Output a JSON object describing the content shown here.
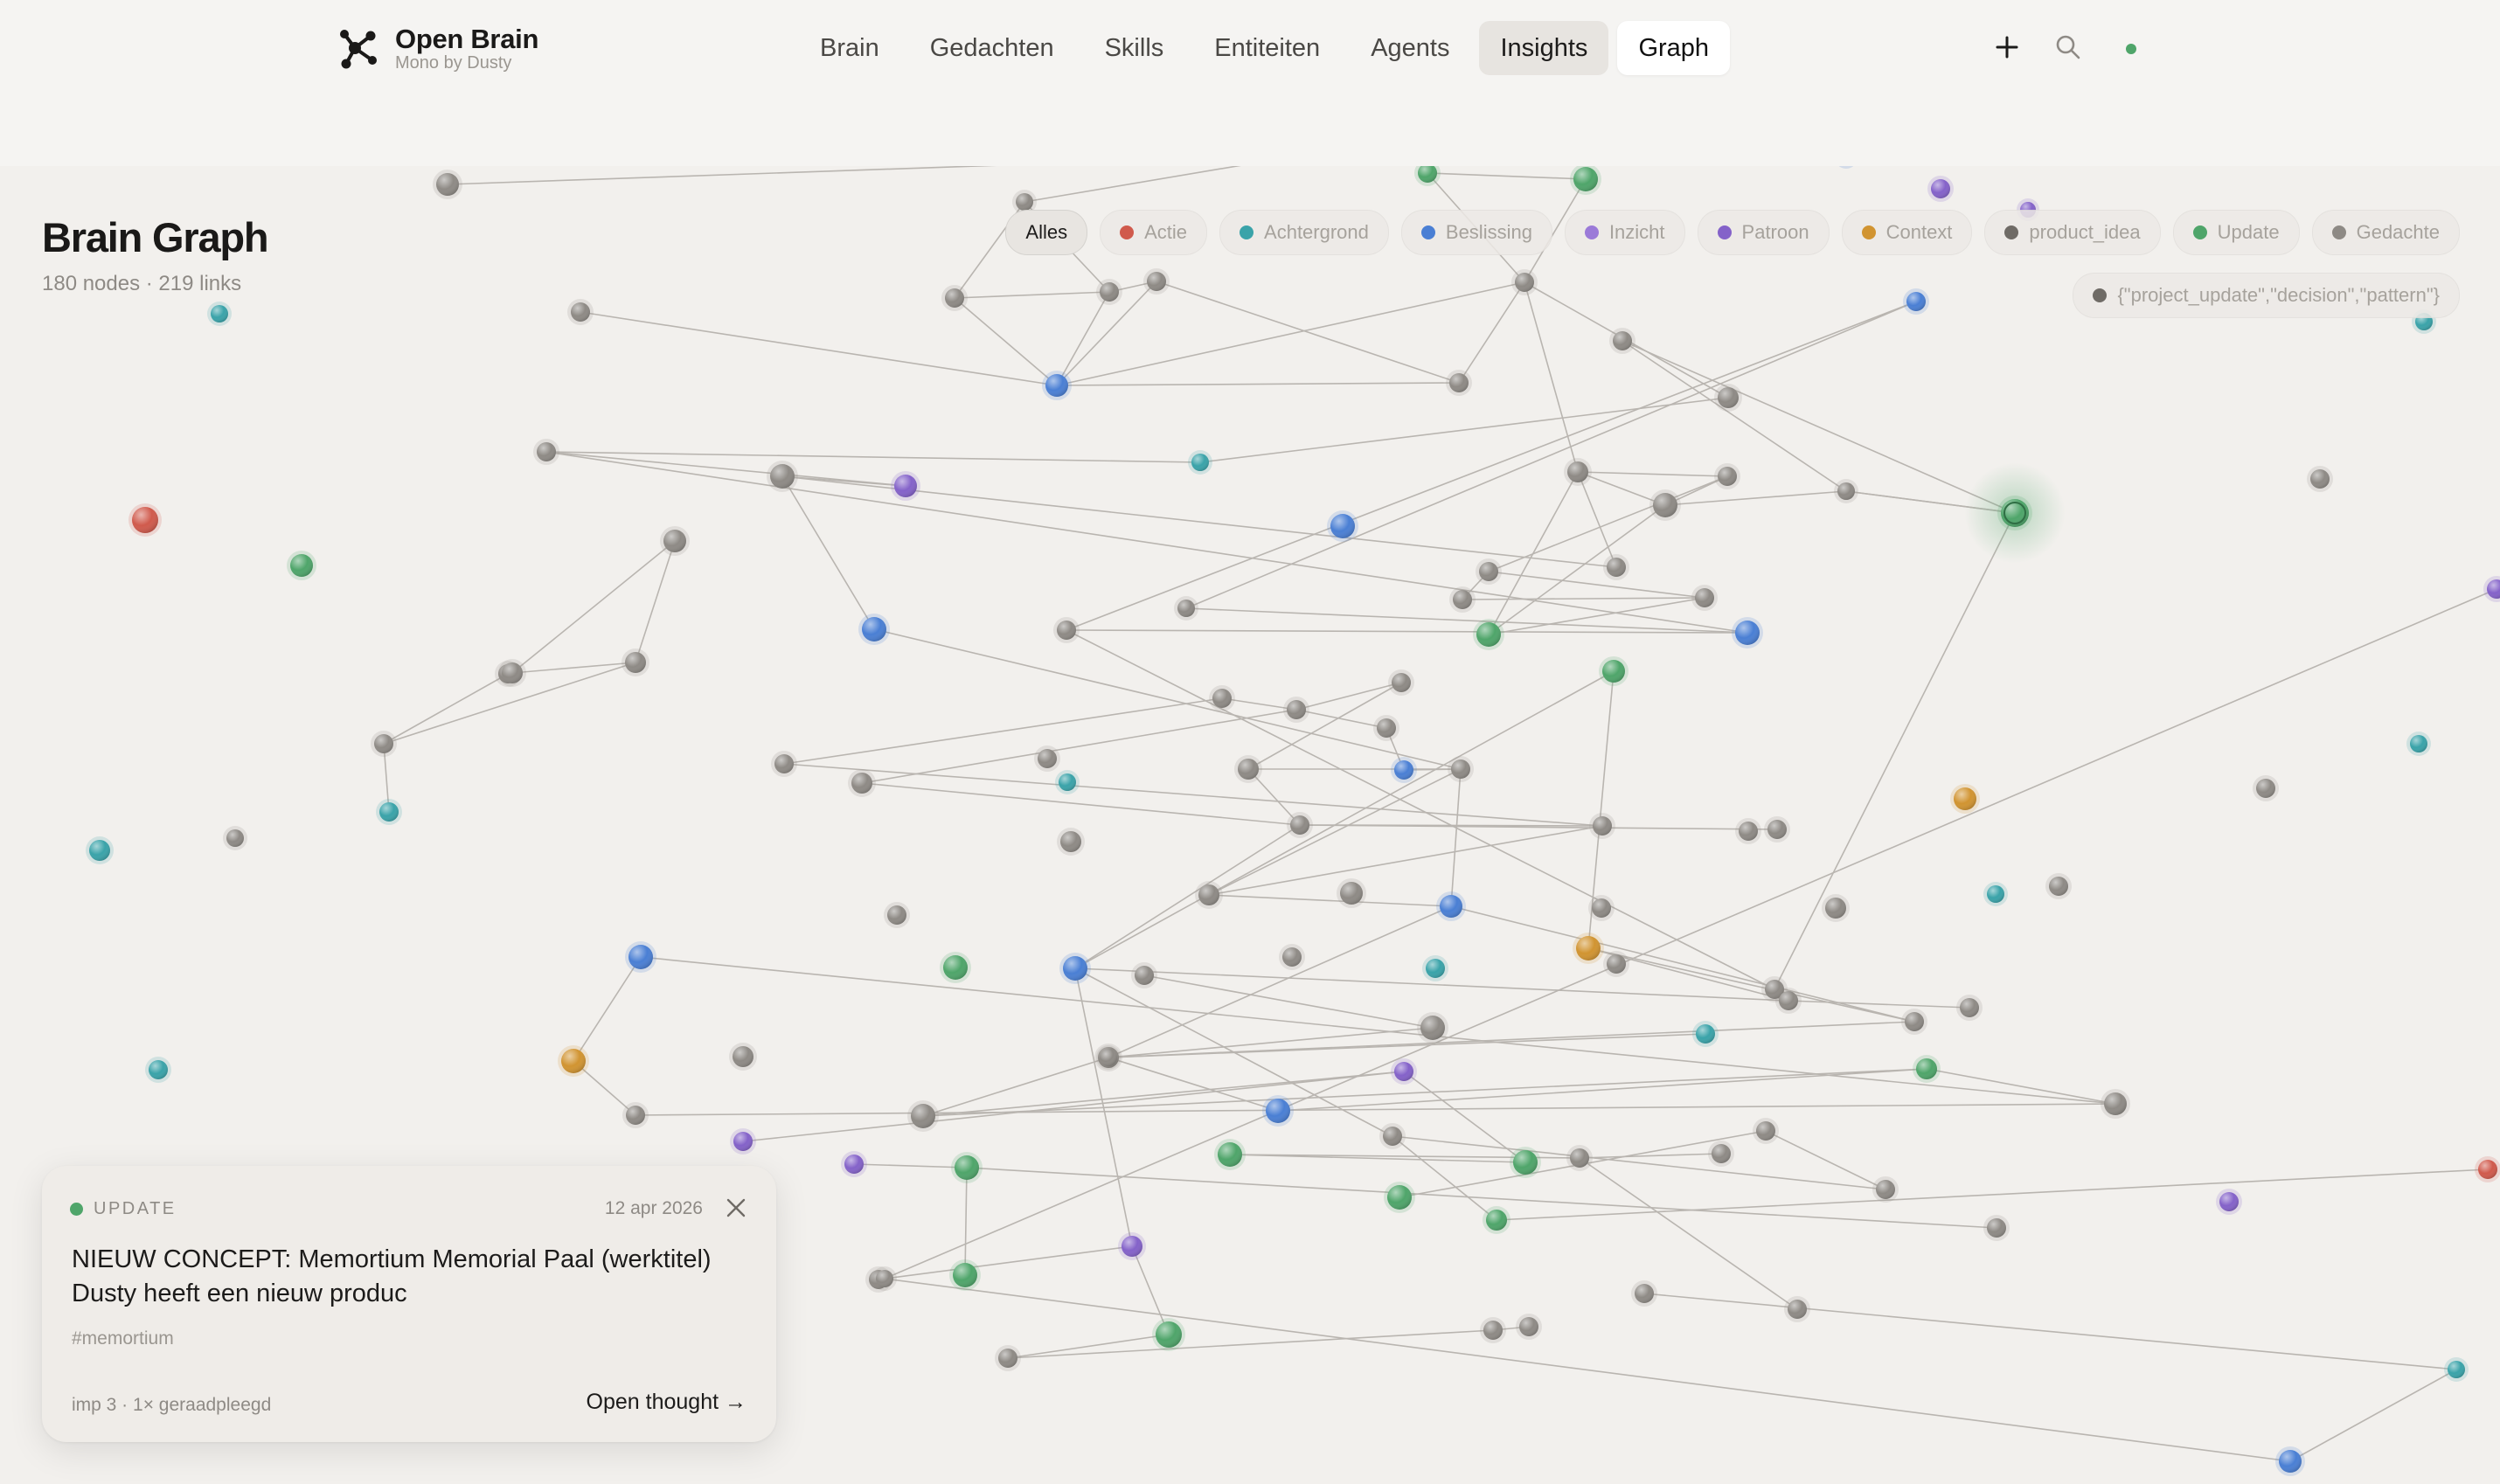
{
  "app": {
    "name": "Open Brain",
    "subtitle": "Mono by Dusty"
  },
  "nav": {
    "items": [
      {
        "label": "Brain"
      },
      {
        "label": "Gedachten"
      },
      {
        "label": "Skills"
      },
      {
        "label": "Entiteiten"
      },
      {
        "label": "Agents"
      },
      {
        "label": "Insights",
        "state": "hover"
      },
      {
        "label": "Graph",
        "state": "active"
      }
    ]
  },
  "header_icons": {
    "add": "plus-icon",
    "search": "search-icon",
    "status": "status-dot"
  },
  "page": {
    "title": "Brain Graph",
    "stats": "180 nodes · 219 links"
  },
  "colors": {
    "actie": "#d05a4c",
    "achtergrond": "#3aa3a9",
    "beslissing": "#4a7fd4",
    "inzicht": "#9b7ad8",
    "patroon": "#8462c9",
    "context": "#d19431",
    "product_idea": "#6f6b66",
    "update": "#4fa56a",
    "gedachte": "#8e8a85"
  },
  "filters": {
    "all": "Alles",
    "items": [
      {
        "label": "Actie",
        "color": "#d05a4c"
      },
      {
        "label": "Achtergrond",
        "color": "#3aa3a9"
      },
      {
        "label": "Beslissing",
        "color": "#4a7fd4"
      },
      {
        "label": "Inzicht",
        "color": "#9b7ad8"
      },
      {
        "label": "Patroon",
        "color": "#8462c9"
      },
      {
        "label": "Context",
        "color": "#d19431"
      },
      {
        "label": "product_idea",
        "color": "#6f6b66"
      },
      {
        "label": "Update",
        "color": "#4fa56a"
      },
      {
        "label": "Gedachte",
        "color": "#8e8a85"
      }
    ],
    "extra": {
      "label": "{\"project_update\",\"decision\",\"pattern\"}",
      "color": "#6f6b66"
    }
  },
  "card": {
    "kind": "UPDATE",
    "date": "12 apr 2026",
    "title": "NIEUW CONCEPT: Memortium Memorial Paal (werktitel) Dusty heeft een nieuw produc",
    "tag": "#memortium",
    "meta": "imp 3 · 1× geraadpleegd",
    "open_label": "Open thought →"
  }
}
